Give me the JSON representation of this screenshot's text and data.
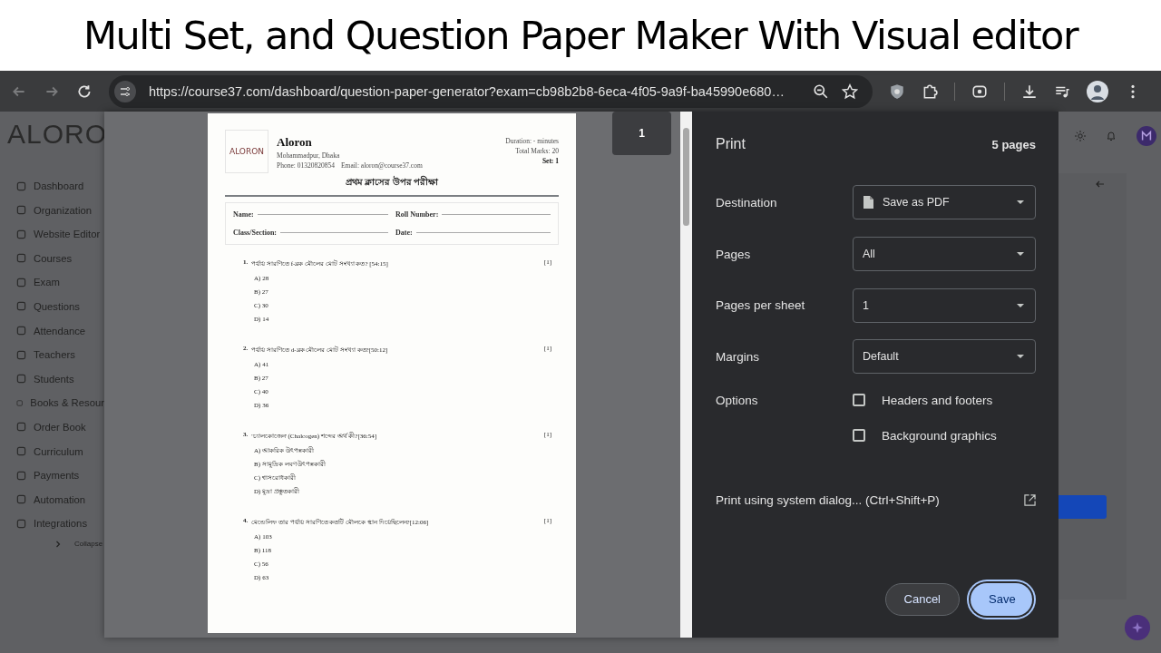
{
  "video_title": "Multi Set, and Question Paper Maker With Visual editor",
  "browser": {
    "url": "https://course37.com/dashboard/question-paper-generator?exam=cb98b2b8-6eca-4f05-9a9f-ba45990e680…"
  },
  "app": {
    "logo": "ALORO",
    "sidebar": [
      "Dashboard",
      "Organization",
      "Website Editor",
      "Courses",
      "Exam",
      "Questions",
      "Attendance",
      "Teachers",
      "Students",
      "Books & Resour",
      "Order Book",
      "Curriculum",
      "Payments",
      "Automation",
      "Integrations"
    ],
    "collapse": "Collapse"
  },
  "preview": {
    "page_number": "1",
    "paper": {
      "logo": "ALORON",
      "name": "Aloron",
      "address": "Mohammadpur, Dhaka",
      "phone": "Phone: 01320820854",
      "email": "Email: aloron@course37.com",
      "duration": "Duration: - minutes",
      "total_marks": "Total Marks: 20",
      "set": "Set: 1",
      "exam_title": "প্রথম ক্লাসের উপর পরীক্ষা",
      "fields": [
        "Name:",
        "Roll Number:",
        "Class/Section:",
        "Date:"
      ],
      "questions": [
        {
          "number": "1.",
          "text": "পর্যায় সারণিতে f-ব্লক মৌলের মোট সংখ্যা কত? [54:15]",
          "marks": "[1]",
          "options": [
            "A) 28",
            "B) 27",
            "C) 30",
            "D) 14"
          ]
        },
        {
          "number": "2.",
          "text": "পর্যায় সারণিতে d-ব্লক মৌলের মোট সংখ্যা কত?[50:12]",
          "marks": "[1]",
          "options": [
            "A) 41",
            "B) 27",
            "C) 40",
            "D) 36"
          ]
        },
        {
          "number": "3.",
          "text": "'চ্যালকোজেন' (Chalcogen) শব্দের অর্থ কী?[36:54]",
          "marks": "[1]",
          "options": [
            "A) আকরিক উৎপন্নকারী",
            "B) সামুদ্রিক লবণ উৎপন্নকারী",
            "C) শ্বাসরোধকারী",
            "D) মুদ্রা প্রস্তুতকারী"
          ]
        },
        {
          "number": "4.",
          "text": "মেন্ডেলিফ তার পর্যায় সারণিতে কতটি মৌলকে স্থান দিয়েছিলেন?[12:06]",
          "marks": "[1]",
          "options": [
            "A) 103",
            "B) 118",
            "C) 56",
            "D) 63"
          ]
        }
      ]
    }
  },
  "print": {
    "title": "Print",
    "page_count": "5 pages",
    "settings": [
      {
        "label": "Destination",
        "value": "Save as PDF",
        "kind": "document"
      },
      {
        "label": "Pages",
        "value": "All",
        "kind": "plain"
      },
      {
        "label": "Pages per sheet",
        "value": "1",
        "kind": "plain"
      },
      {
        "label": "Margins",
        "value": "Default",
        "kind": "plain"
      }
    ],
    "options_label": "Options",
    "options": [
      {
        "label": "Headers and footers",
        "checked": false
      },
      {
        "label": "Background graphics",
        "checked": false
      }
    ],
    "system_dialog": "Print using system dialog... (Ctrl+Shift+P)",
    "buttons": [
      {
        "label": "Cancel",
        "kind": "secondary"
      },
      {
        "label": "Save",
        "kind": "primary"
      }
    ]
  }
}
